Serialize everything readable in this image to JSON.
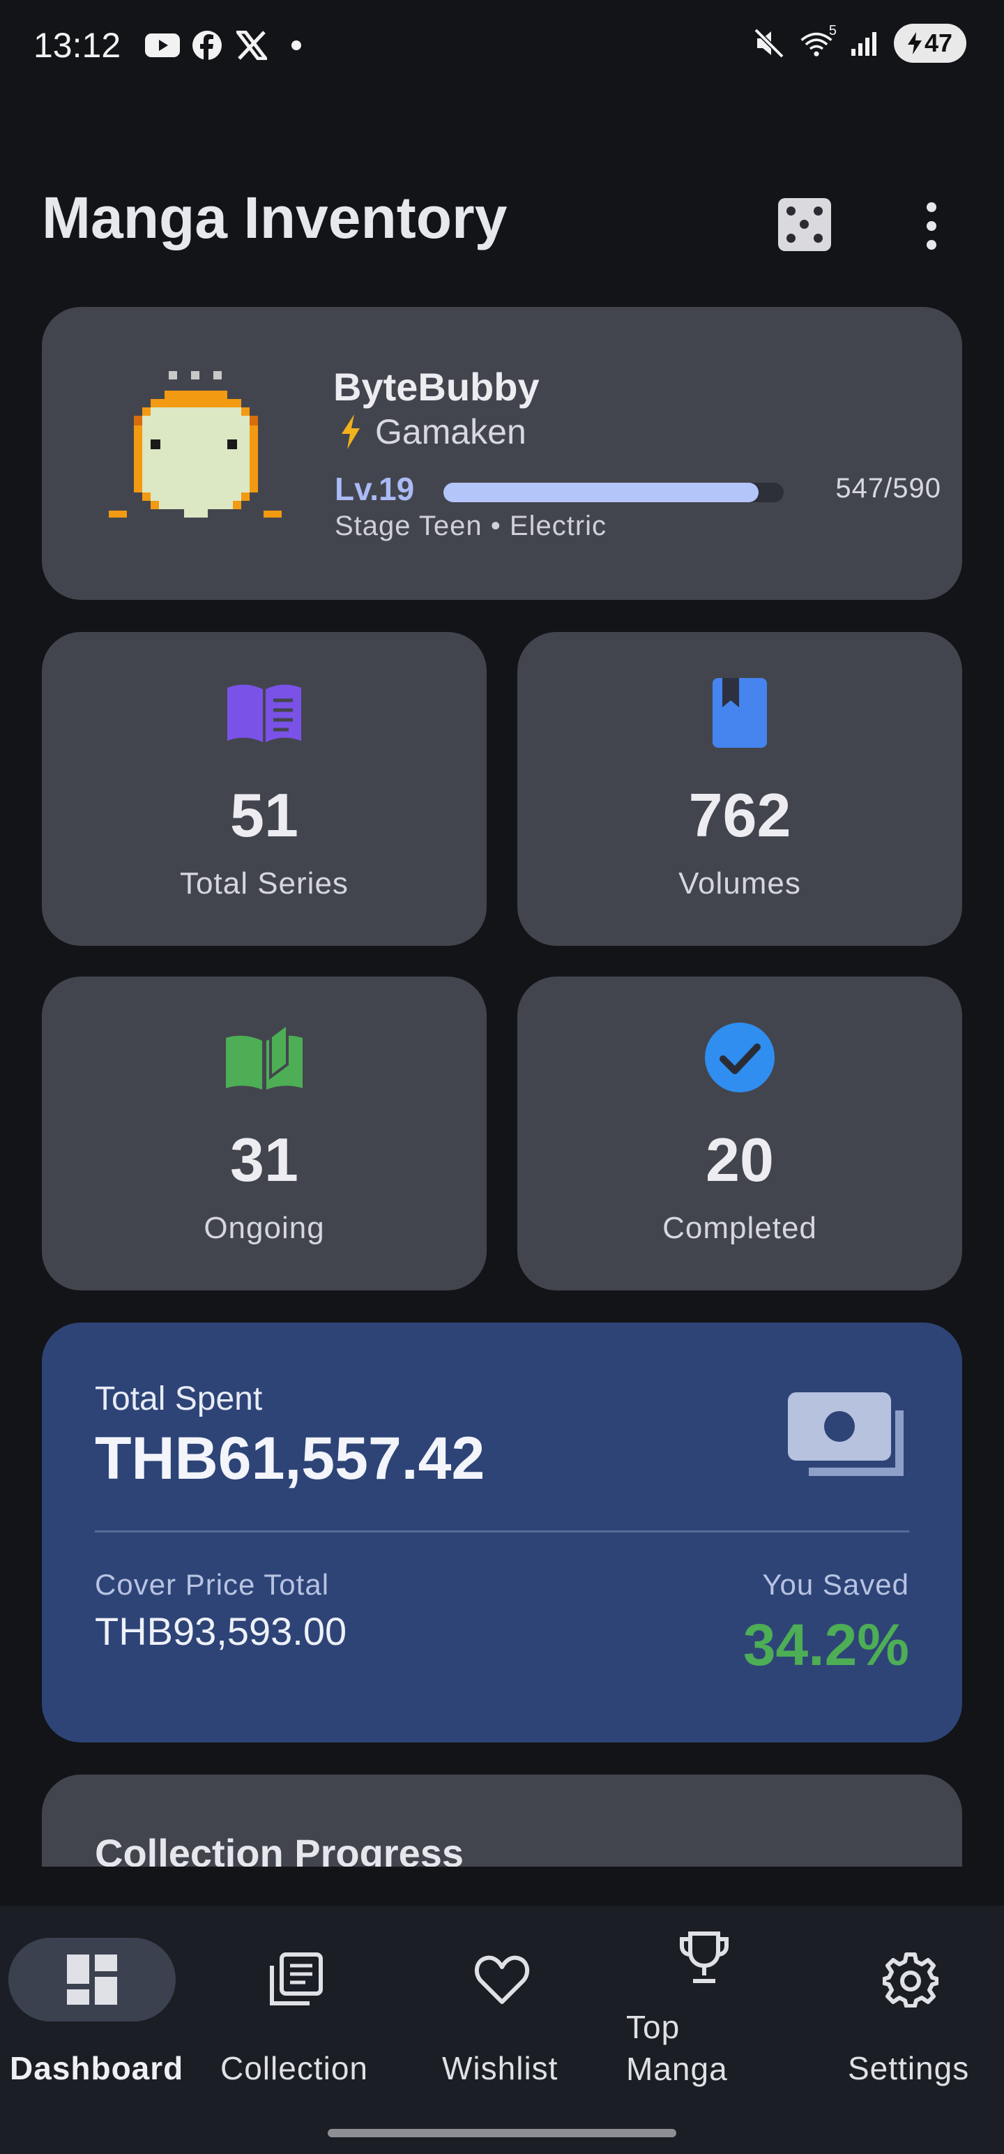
{
  "status_bar": {
    "time": "13:12",
    "left_icons": [
      "youtube-icon",
      "facebook-icon",
      "x-icon",
      "dot-icon"
    ],
    "right_icons": [
      "mute-icon",
      "wifi-icon",
      "signal-icon"
    ],
    "wifi_badge": "5",
    "battery": "47"
  },
  "header": {
    "title": "Manga Inventory",
    "actions": [
      "dice-icon",
      "more-vert-icon"
    ]
  },
  "pet": {
    "name": "ByteBubby",
    "owner": "Gamaken",
    "owner_icon": "lightning-icon",
    "level": "Lv.19",
    "xp": "547/590",
    "xp_fraction": 0.927,
    "stage": "Stage Teen • Electric",
    "colors": {
      "xp_bar": "#b4c5fa",
      "level_text": "#aabbf6"
    }
  },
  "stats": [
    {
      "value": "51",
      "label": "Total Series",
      "icon": "open-book-icon",
      "color": "#7a52e8"
    },
    {
      "value": "762",
      "label": "Volumes",
      "icon": "bookmark-book-icon",
      "color": "#4684ef"
    },
    {
      "value": "31",
      "label": "Ongoing",
      "icon": "reading-book-icon",
      "color": "#4dae55"
    },
    {
      "value": "20",
      "label": "Completed",
      "icon": "check-circle-icon",
      "color": "#2f8ef0"
    }
  ],
  "spending": {
    "total_label": "Total Spent",
    "total_value": "THB61,557.42",
    "icon": "money-icon",
    "cover_label": "Cover Price Total",
    "cover_value": "THB93,593.00",
    "saved_label": "You Saved",
    "saved_value": "34.2%",
    "colors": {
      "card": "#2e4477",
      "saved": "#4dae55"
    }
  },
  "progress": {
    "title": "Collection Progress"
  },
  "nav": {
    "selected": "Dashboard",
    "items": [
      {
        "label": "Dashboard",
        "icon": "dashboard-icon"
      },
      {
        "label": "Collection",
        "icon": "collection-icon"
      },
      {
        "label": "Wishlist",
        "icon": "heart-icon"
      },
      {
        "label": "Top\nManga",
        "icon": "trophy-icon"
      },
      {
        "label": "Settings",
        "icon": "gear-icon"
      }
    ]
  }
}
